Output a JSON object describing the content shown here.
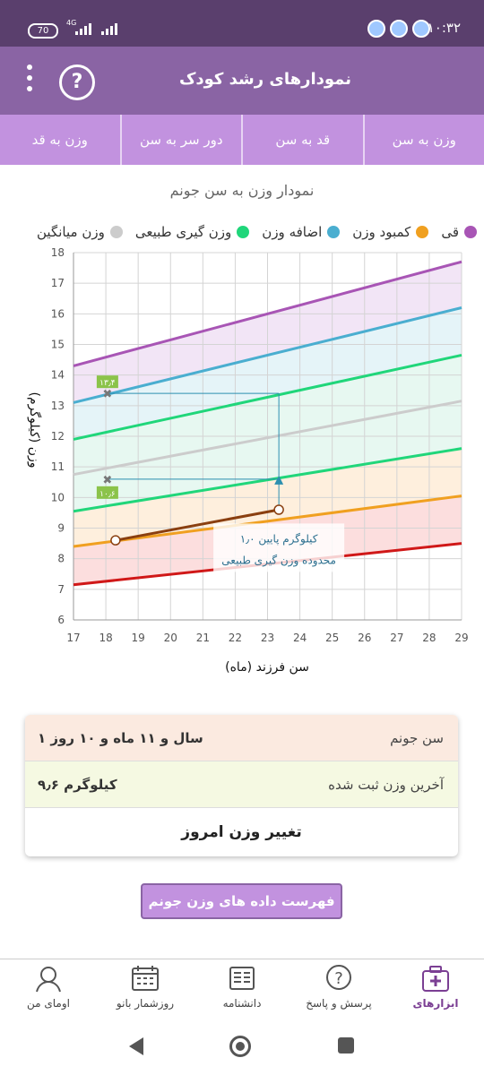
{
  "status_bar": {
    "time": "۱۰:۳۲",
    "battery": "70",
    "network": "4G"
  },
  "app_bar": {
    "title": "نمودارهای رشد کودک",
    "help_label": "?"
  },
  "tabs": [
    {
      "label": "وزن به سن",
      "active": true
    },
    {
      "label": "قد به سن",
      "active": false
    },
    {
      "label": "دور سر به سن",
      "active": false
    },
    {
      "label": "وزن به قد",
      "active": false
    }
  ],
  "chart_title": "نمودار وزن به سن جونم",
  "legend": [
    {
      "label": "قی",
      "color": "#a855b5"
    },
    {
      "label": "کمبود وزن",
      "color": "#f0a020"
    },
    {
      "label": "اضافه وزن",
      "color": "#4aaed0"
    },
    {
      "label": "وزن گیری طبیعی",
      "color": "#20d67a"
    },
    {
      "label": "وزن میانگین",
      "color": "#cccccc"
    }
  ],
  "chart_data": {
    "type": "line",
    "xlabel": "سن فرزند (ماه)",
    "ylabel": "وزن (کیلوگرم)",
    "xlim": [
      17,
      29
    ],
    "ylim": [
      6,
      18
    ],
    "x_ticks": [
      17,
      18,
      19,
      20,
      21,
      22,
      23,
      24,
      25,
      26,
      27,
      28,
      29
    ],
    "y_ticks": [
      6,
      7,
      8,
      9,
      10,
      11,
      12,
      13,
      14,
      15,
      16,
      17,
      18
    ],
    "grid": true,
    "series": [
      {
        "name": "قی",
        "color": "#a855b5",
        "x": [
          17,
          29
        ],
        "y": [
          14.3,
          17.7
        ]
      },
      {
        "name": "اضافه وزن",
        "color": "#4aaed0",
        "x": [
          17,
          29
        ],
        "y": [
          13.1,
          16.2
        ]
      },
      {
        "name": "وزن گیری طبیعی",
        "color": "#20d67a",
        "x": [
          17,
          29
        ],
        "y": [
          11.9,
          14.65
        ]
      },
      {
        "name": "وزن میانگین",
        "color": "#cccccc",
        "x": [
          17,
          29
        ],
        "y": [
          10.75,
          13.15
        ]
      },
      {
        "name": "وزن گیری طبیعی",
        "color": "#20d67a",
        "x": [
          17,
          29
        ],
        "y": [
          9.55,
          11.6
        ]
      },
      {
        "name": "کمبود وزن",
        "color": "#f0a020",
        "x": [
          17,
          29
        ],
        "y": [
          8.4,
          10.05
        ]
      },
      {
        "color": "#d01818",
        "x": [
          17,
          29
        ],
        "y": [
          7.15,
          8.5
        ]
      }
    ],
    "bands": [
      {
        "color": "#eedcf3",
        "from": 1,
        "to": 0
      },
      {
        "color": "#dcf0f6",
        "from": 2,
        "to": 1
      },
      {
        "color": "#dff5ec",
        "from": 4,
        "to": 2
      },
      {
        "color": "#fde9d2",
        "from": 5,
        "to": 4
      },
      {
        "color": "#fbd3d3",
        "from": 6,
        "to": 5
      }
    ],
    "child_weights": {
      "x": [
        18.3,
        23.35
      ],
      "y": [
        8.6,
        9.6
      ],
      "color": "#8a3f10"
    },
    "age_marker": {
      "x": 23.35,
      "upper": 13.4,
      "lower": 10.6
    },
    "markers": [
      {
        "x": 18.05,
        "y": 13.4,
        "label": "۱۳٫۴"
      },
      {
        "x": 18.05,
        "y": 10.6,
        "label": "۱۰٫۶"
      }
    ],
    "annotation": {
      "x": 23.35,
      "line1": "۱٫۰ کیلوگرم پایین",
      "line2": "محدوده وزن گیری طبیعی"
    }
  },
  "info": {
    "age_label": "سن جونم",
    "age_value": "۱ سال و ۱۱ ماه و ۱۰ روز",
    "last_weight_label": "آخرین وزن ثبت شده",
    "last_weight_value": "۹٫۶ کیلوگرم",
    "change_today": "تغییر وزن امروز"
  },
  "list_button": "فهرست داده های وزن جونم",
  "bottom_nav": [
    {
      "label": "ابزارهای",
      "icon": "medical-kit-icon",
      "active": true
    },
    {
      "label": "پرسش و پاسخ",
      "icon": "question-bubble-icon",
      "active": false
    },
    {
      "label": "دانشنامه",
      "icon": "encyclopedia-icon",
      "active": false
    },
    {
      "label": "روزشمار بانو",
      "icon": "calendar-icon",
      "active": false
    },
    {
      "label": "اومای من",
      "icon": "profile-avatar-icon",
      "active": false
    }
  ]
}
